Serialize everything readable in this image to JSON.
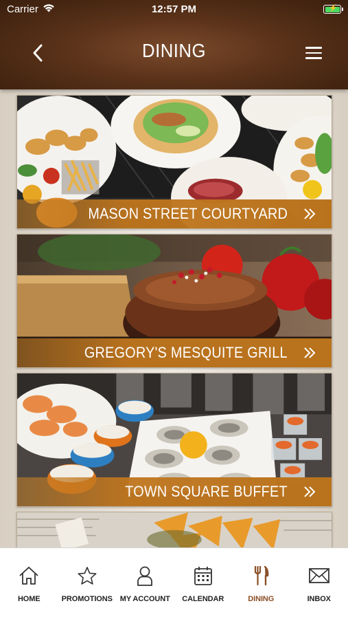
{
  "status_bar": {
    "carrier": "Carrier",
    "time": "12:57 PM",
    "battery_color": "#4cd964"
  },
  "header": {
    "title": "DINING",
    "back_icon": "chevron-left-icon",
    "menu_icon": "hamburger-menu-icon"
  },
  "venues": [
    {
      "name": "MASON STREET COURTYARD",
      "image": "platters-seafood-salad-fries",
      "chevron": "double-chevron-right-icon"
    },
    {
      "name": "GREGORY'S MESQUITE GRILL",
      "image": "grilled-steak-tomatoes",
      "chevron": "double-chevron-right-icon"
    },
    {
      "name": "TOWN SQUARE BUFFET",
      "image": "oysters-shrimp-buffet",
      "chevron": "double-chevron-right-icon"
    },
    {
      "name": "",
      "image": "nachos-partial",
      "chevron": ""
    }
  ],
  "tabbar": {
    "active_color": "#8a4f25",
    "items": [
      {
        "label": "HOME",
        "icon": "home-icon"
      },
      {
        "label": "PROMOTIONS",
        "icon": "star-icon"
      },
      {
        "label": "MY ACCOUNT",
        "icon": "person-icon"
      },
      {
        "label": "CALENDAR",
        "icon": "calendar-icon"
      },
      {
        "label": "DINING",
        "icon": "fork-knife-icon"
      },
      {
        "label": "INBOX",
        "icon": "envelope-icon"
      }
    ]
  },
  "colors": {
    "header_brown": "#5a3219",
    "banner_gold": "#b9731d"
  }
}
